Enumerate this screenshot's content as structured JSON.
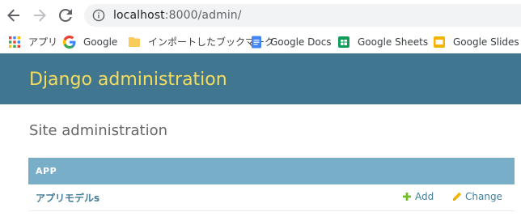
{
  "browser": {
    "url_host": "localhost",
    "url_rest": ":8000/admin/",
    "icons": [
      "back-arrow-icon",
      "forward-arrow-icon",
      "reload-icon",
      "info-icon"
    ]
  },
  "bookmarks": [
    {
      "label": "アプリ",
      "icon": "apps-grid-icon"
    },
    {
      "label": "Google",
      "icon": "google-g-icon"
    },
    {
      "label": "インポートしたブックマーク",
      "icon": "folder-icon"
    },
    {
      "label": "Google Docs",
      "icon": "google-docs-icon"
    },
    {
      "label": "Google Sheets",
      "icon": "google-sheets-icon"
    },
    {
      "label": "Google Slides",
      "icon": "google-slides-icon"
    }
  ],
  "header": {
    "site_name": "Django administration"
  },
  "content": {
    "title": "Site administration",
    "app_module": {
      "caption": "APP",
      "models": [
        {
          "name": "アプリモデルs",
          "add_label": "Add",
          "change_label": "Change"
        }
      ]
    }
  },
  "colors": {
    "header_bg": "#417690",
    "header_title": "#f5dd5d",
    "caption_bg": "#79aec8",
    "link": "#447e9b",
    "add_icon": "#70bf2b",
    "change_icon": "#efb80b"
  }
}
